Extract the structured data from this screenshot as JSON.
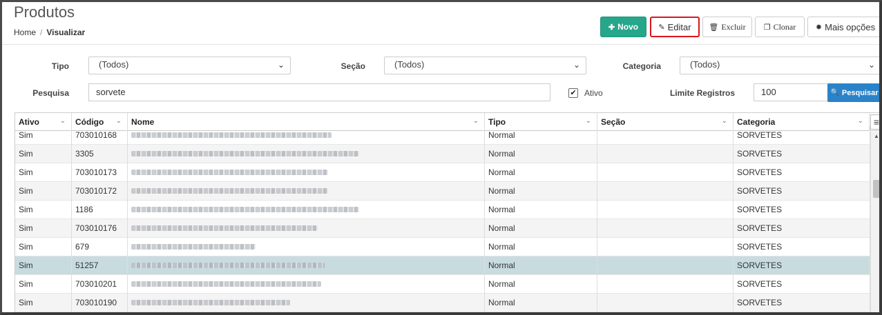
{
  "header": {
    "title": "Produtos",
    "breadcrumb_home": "Home",
    "breadcrumb_sep": "/",
    "breadcrumb_current": "Visualizar"
  },
  "toolbar": {
    "novo": "Novo",
    "editar": "Editar",
    "excluir": "Excluir",
    "clonar": "Clonar",
    "mais": "Mais opções"
  },
  "filters": {
    "tipo_label": "Tipo",
    "tipo_value": "(Todos)",
    "secao_label": "Seção",
    "secao_value": "(Todos)",
    "categoria_label": "Categoria",
    "categoria_value": "(Todos)",
    "pesquisa_label": "Pesquisa",
    "pesquisa_value": "sorvete",
    "ativo_label": "Ativo",
    "ativo_checked": true,
    "limite_label": "Limite Registros",
    "limite_value": "100",
    "pesquisar_button": "Pesquisar"
  },
  "grid": {
    "columns": [
      "Ativo",
      "Código",
      "Nome",
      "Tipo",
      "Seção",
      "Categoria"
    ],
    "selected_row_index": 7,
    "rows": [
      {
        "ativo": "Sim",
        "codigo": "703010168",
        "tipo": "Normal",
        "secao": "",
        "categoria": "SORVETES"
      },
      {
        "ativo": "Sim",
        "codigo": "3305",
        "tipo": "Normal",
        "secao": "",
        "categoria": "SORVETES"
      },
      {
        "ativo": "Sim",
        "codigo": "703010173",
        "tipo": "Normal",
        "secao": "",
        "categoria": "SORVETES"
      },
      {
        "ativo": "Sim",
        "codigo": "703010172",
        "tipo": "Normal",
        "secao": "",
        "categoria": "SORVETES"
      },
      {
        "ativo": "Sim",
        "codigo": "1186",
        "tipo": "Normal",
        "secao": "",
        "categoria": "SORVETES"
      },
      {
        "ativo": "Sim",
        "codigo": "703010176",
        "tipo": "Normal",
        "secao": "",
        "categoria": "SORVETES"
      },
      {
        "ativo": "Sim",
        "codigo": "679",
        "tipo": "Normal",
        "secao": "",
        "categoria": "SORVETES"
      },
      {
        "ativo": "Sim",
        "codigo": "51257",
        "tipo": "Normal",
        "secao": "",
        "categoria": "SORVETES"
      },
      {
        "ativo": "Sim",
        "codigo": "703010201",
        "tipo": "Normal",
        "secao": "",
        "categoria": "SORVETES"
      },
      {
        "ativo": "Sim",
        "codigo": "703010190",
        "tipo": "Normal",
        "secao": "",
        "categoria": "SORVETES"
      }
    ]
  },
  "colors": {
    "novo_button": "#26a68a",
    "pesquisar_button": "#2a83c9",
    "highlight_border": "#d9141b",
    "selected_row": "#c8dcdf"
  }
}
